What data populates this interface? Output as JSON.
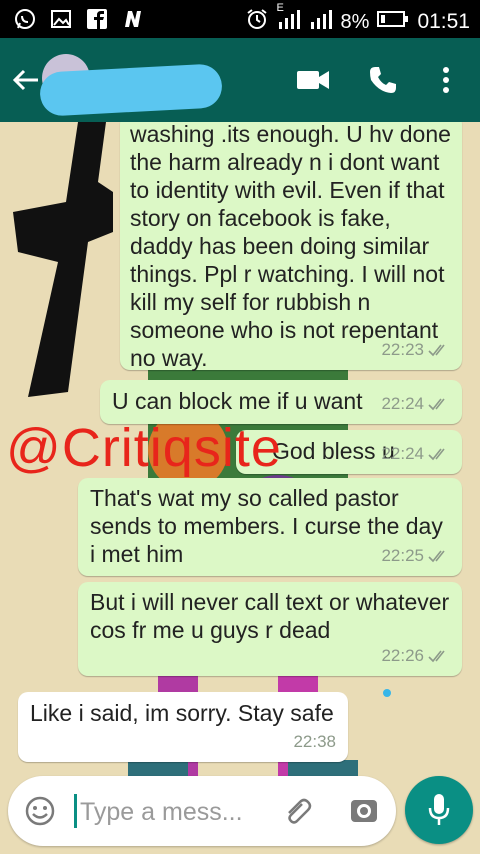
{
  "status_bar": {
    "battery_percent": "8%",
    "time": "01:51",
    "network_label": "E",
    "icons": [
      "whatsapp-icon",
      "gallery-icon",
      "facebook-icon",
      "n-icon",
      "alarm-icon",
      "signal-icon",
      "signal-icon",
      "battery-icon"
    ]
  },
  "header": {
    "icons": [
      "back-arrow-icon",
      "video-call-icon",
      "phone-call-icon",
      "more-options-icon"
    ]
  },
  "messages": [
    {
      "type": "out",
      "text": "washing .its enough. U hv done the harm already n i dont want to identity with evil. Even if that story on facebook is fake, daddy has been doing similar things. Ppl r watching. I will not kill my self for rubbish n someone who is not repentant no way.",
      "time": "22:23"
    },
    {
      "type": "out",
      "text": "U can block me if u want",
      "time": "22:24"
    },
    {
      "type": "out",
      "text": "God bless u",
      "time": "22:24"
    },
    {
      "type": "out",
      "text": "That's wat my so called pastor sends to members. I curse the day i met him",
      "time": "22:25"
    },
    {
      "type": "out",
      "text": "But i will never call text or whatever cos fr me u guys r dead",
      "time": "22:26"
    },
    {
      "type": "in",
      "text": "Like i said, im sorry. Stay safe",
      "time": "22:38"
    }
  ],
  "watermark": "@Critiqsite",
  "input": {
    "placeholder": "Type a mess..."
  },
  "colors": {
    "header": "#075e54",
    "outgoing_bubble": "#dcf8c6",
    "incoming_bubble": "#ffffff",
    "accent": "#0a8f84",
    "watermark": "#e8251b",
    "redaction": "#5bc6f0"
  }
}
